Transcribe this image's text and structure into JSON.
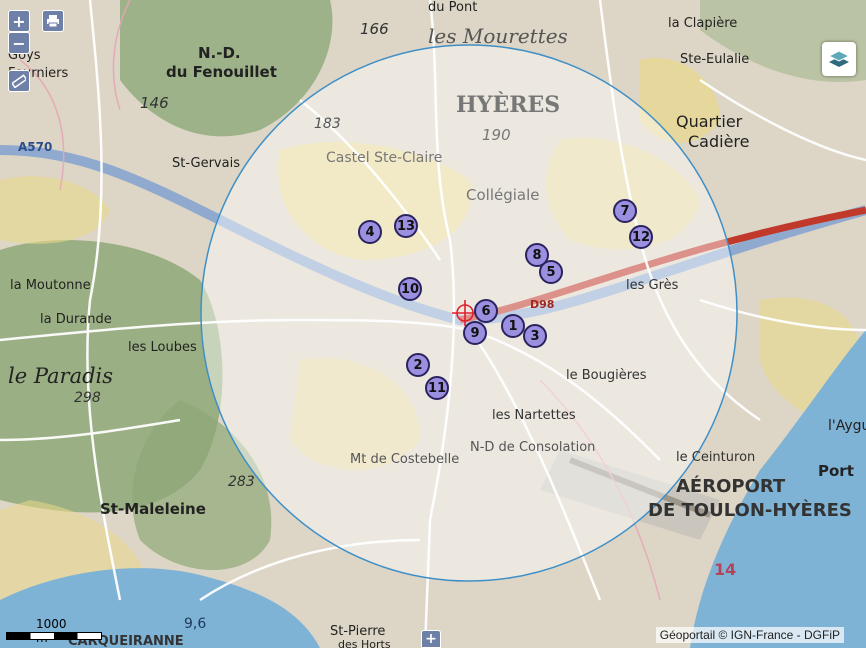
{
  "colors": {
    "marker_fill": "#9b8fe0",
    "marker_stroke": "#2b2360",
    "radius_circle_fill": "#ffffff",
    "radius_circle_stroke": "#3f8fc7",
    "target_color": "#e0202a",
    "control_bg": "#6e7fa8",
    "sea": "#7fb3d6",
    "forest": "#8fa878",
    "urban": "#e9d98a",
    "highway": "#c0392b"
  },
  "controls": {
    "zoom_in": "+",
    "zoom_out": "−",
    "print_icon": "printer-icon",
    "measure_icon": "ruler-icon",
    "layers_icon": "layers-icon",
    "expand_label": "+"
  },
  "scale_label": "1000 m",
  "attribution": "Géoportail © IGN-France - DGFiP",
  "markers": [
    "1",
    "2",
    "3",
    "4",
    "5",
    "6",
    "7",
    "8",
    "9",
    "10",
    "11",
    "12",
    "13"
  ],
  "places": {
    "hyeres": "HYÈRES",
    "mourettes": "les Mourettes",
    "nd_fenouillet_1": "N.-D.",
    "nd_fenouillet_2": "du Fenouillet",
    "goys": "Goys",
    "fourniers": "Fourniers",
    "clapiere": "la Clapière",
    "ste_eulalie": "Ste-Eulalie",
    "quartier": "Quartier",
    "cadiere": "Cadière",
    "le_paradis": "le Paradis",
    "durande": "la Durande",
    "moutonne": "la Moutonne",
    "loubes": "les Loubes",
    "st_maleleine": "St-Maleleine",
    "aeroport": "AÉROPORT",
    "toulon_hyeres": "DE TOULON-HYÈRES",
    "port": "Port",
    "st_pierre_1": "St-Pierre",
    "st_pierre_2": "des Horts",
    "les_gres": "les Grès",
    "bougieres": "le Bougières",
    "les_nartettes": "les Nartettes",
    "consolation": "N-D de Consolation",
    "costebelle": "Mt de Costebelle",
    "st_gervais": "St-Gervais",
    "le_pont": "du Pont",
    "collegiale": "Collégiale",
    "ste_claire": "Castel Ste-Claire",
    "aygue": "l'Aygue",
    "le_ceinturon": "le Ceinturon",
    "carqueiranne": "CARQUEIRANNE",
    "spot_166": "166",
    "spot_146": "146",
    "spot_183": "183",
    "spot_190": "190",
    "spot_298": "298",
    "spot_283": "283",
    "spot_96": "9,6",
    "road_a570": "A570",
    "road_d98": "D98",
    "sea_14": "14"
  }
}
